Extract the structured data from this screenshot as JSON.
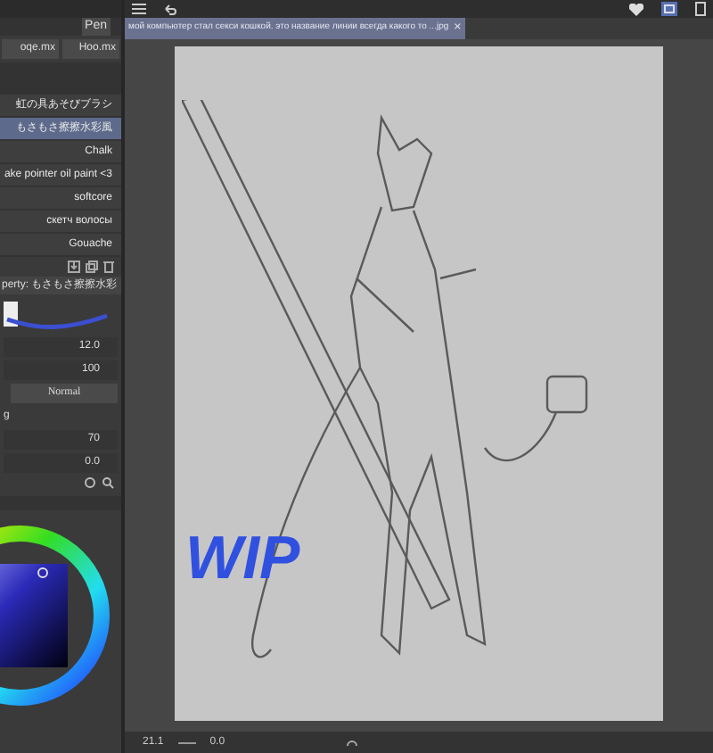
{
  "tool_tab": {
    "label": "Pen"
  },
  "brush_groups": [
    {
      "label": "oqe.mx"
    },
    {
      "label": "Hoo.mx"
    }
  ],
  "brushes": [
    {
      "label": "虹の具あそびブラシ",
      "selected": false
    },
    {
      "label": "もさもさ擦擦水彩風",
      "selected": true
    },
    {
      "label": "Chalk",
      "selected": false
    },
    {
      "label": "ake pointer oil paint <3",
      "selected": false
    },
    {
      "label": "softcore",
      "selected": false
    },
    {
      "label": "скетч волосы",
      "selected": false
    },
    {
      "label": "Gouache",
      "selected": false
    }
  ],
  "property_title": "perty: もさもさ擦擦水彩",
  "properties": [
    {
      "kind": "number",
      "value": "12.0"
    },
    {
      "kind": "number",
      "value": "100"
    },
    {
      "kind": "dropdown",
      "value": "Normal"
    },
    {
      "kind": "label",
      "value": "g"
    },
    {
      "kind": "number",
      "value": "70"
    },
    {
      "kind": "number",
      "value": "0.0"
    }
  ],
  "document_tab": {
    "title": "мой компьютер стал секси кошкой. это название линии всегда какого то ...jpg",
    "close": "×"
  },
  "canvas": {
    "wip_text": "WIP"
  },
  "status_bar": {
    "zoom": "21.1",
    "angle": "0.0"
  }
}
